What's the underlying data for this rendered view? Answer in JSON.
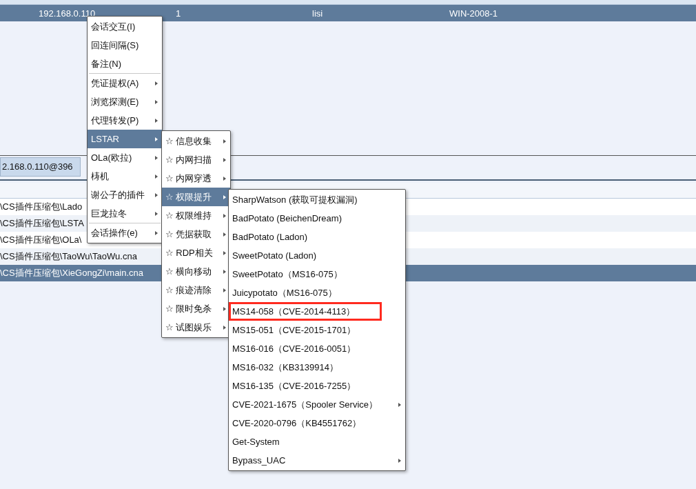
{
  "sessions_table": {
    "rows": [
      {
        "cells": [
          "192.168.0.110",
          "1",
          "lisi",
          "WIN-2008-1"
        ],
        "selected": true
      }
    ]
  },
  "tabs": [
    {
      "label": "2.168.0.110@396",
      "selected": true
    }
  ],
  "scripts_table": {
    "rows": [
      {
        "path": "\\CS插件压缩包\\Lado",
        "selected": false
      },
      {
        "path": "\\CS插件压缩包\\LSTA",
        "selected": false
      },
      {
        "path": "\\CS插件压缩包\\OLa\\",
        "selected": false
      },
      {
        "path": "\\CS插件压缩包\\TaoWu\\TaoWu.cna",
        "selected": false
      },
      {
        "path": "\\CS插件压缩包\\XieGongZi\\main.cna",
        "selected": true
      }
    ]
  },
  "menus": [
    {
      "items": [
        {
          "kind": "item",
          "label": "会话交互(I)",
          "submenu": false,
          "selected": false
        },
        {
          "kind": "item",
          "label": "回连间隔(S)",
          "submenu": false,
          "selected": false
        },
        {
          "kind": "item",
          "label": "备注(N)",
          "submenu": false,
          "selected": false
        },
        {
          "kind": "separator"
        },
        {
          "kind": "item",
          "label": "凭证提权(A)",
          "submenu": true,
          "selected": false
        },
        {
          "kind": "item",
          "label": "浏览探测(E)",
          "submenu": true,
          "selected": false
        },
        {
          "kind": "item",
          "label": "代理转发(P)",
          "submenu": true,
          "selected": false
        },
        {
          "kind": "item",
          "label": "LSTAR",
          "submenu": true,
          "selected": true
        },
        {
          "kind": "item",
          "label": "OLa(欧拉)",
          "submenu": true,
          "selected": false
        },
        {
          "kind": "item",
          "label": "梼机",
          "submenu": true,
          "selected": false
        },
        {
          "kind": "item",
          "label": "谢公子的插件",
          "submenu": true,
          "selected": false
        },
        {
          "kind": "item",
          "label": "巨龙拉冬",
          "submenu": true,
          "selected": false
        },
        {
          "kind": "separator"
        },
        {
          "kind": "item",
          "label": "会话操作(e)",
          "submenu": true,
          "selected": false
        }
      ]
    },
    {
      "items": [
        {
          "kind": "item",
          "label": "☆ 信息收集",
          "submenu": true,
          "selected": false
        },
        {
          "kind": "item",
          "label": "☆ 内网扫描",
          "submenu": true,
          "selected": false
        },
        {
          "kind": "item",
          "label": "☆ 内网穿透",
          "submenu": true,
          "selected": false
        },
        {
          "kind": "item",
          "label": "☆ 权限提升",
          "submenu": true,
          "selected": true
        },
        {
          "kind": "item",
          "label": "☆ 权限维持",
          "submenu": true,
          "selected": false
        },
        {
          "kind": "item",
          "label": "☆ 凭据获取",
          "submenu": true,
          "selected": false
        },
        {
          "kind": "item",
          "label": "☆ RDP相关",
          "submenu": true,
          "selected": false
        },
        {
          "kind": "item",
          "label": "☆ 横向移动",
          "submenu": true,
          "selected": false
        },
        {
          "kind": "item",
          "label": "☆ 痕迹清除",
          "submenu": true,
          "selected": false
        },
        {
          "kind": "item",
          "label": "☆ 限时免杀",
          "submenu": true,
          "selected": false
        },
        {
          "kind": "item",
          "label": "☆ 试图娱乐",
          "submenu": true,
          "selected": false
        }
      ]
    },
    {
      "items": [
        {
          "kind": "item",
          "label": "SharpWatson (获取可提权漏洞)",
          "submenu": false,
          "selected": false
        },
        {
          "kind": "item",
          "label": "BadPotato (BeichenDream)",
          "submenu": false,
          "selected": false
        },
        {
          "kind": "item",
          "label": "BadPotato (Ladon)",
          "submenu": false,
          "selected": false
        },
        {
          "kind": "item",
          "label": "SweetPotato (Ladon)",
          "submenu": false,
          "selected": false
        },
        {
          "kind": "item",
          "label": "SweetPotato（MS16-075）",
          "submenu": false,
          "selected": false
        },
        {
          "kind": "item",
          "label": "Juicypotato（MS16-075）",
          "submenu": false,
          "selected": false
        },
        {
          "kind": "item",
          "label": "MS14-058（CVE-2014-4113）",
          "submenu": false,
          "selected": false,
          "highlighted": true
        },
        {
          "kind": "item",
          "label": "MS15-051（CVE-2015-1701）",
          "submenu": false,
          "selected": false
        },
        {
          "kind": "item",
          "label": "MS16-016（CVE-2016-0051）",
          "submenu": false,
          "selected": false
        },
        {
          "kind": "item",
          "label": "MS16-032（KB3139914）",
          "submenu": false,
          "selected": false
        },
        {
          "kind": "item",
          "label": "MS16-135（CVE-2016-7255）",
          "submenu": false,
          "selected": false
        },
        {
          "kind": "item",
          "label": "CVE-2021-1675（Spooler Service）",
          "submenu": true,
          "selected": false
        },
        {
          "kind": "item",
          "label": "CVE-2020-0796（KB4551762）",
          "submenu": false,
          "selected": false
        },
        {
          "kind": "item",
          "label": "Get-System",
          "submenu": false,
          "selected": false
        },
        {
          "kind": "item",
          "label": "Bypass_UAC",
          "submenu": true,
          "selected": false
        }
      ]
    }
  ]
}
